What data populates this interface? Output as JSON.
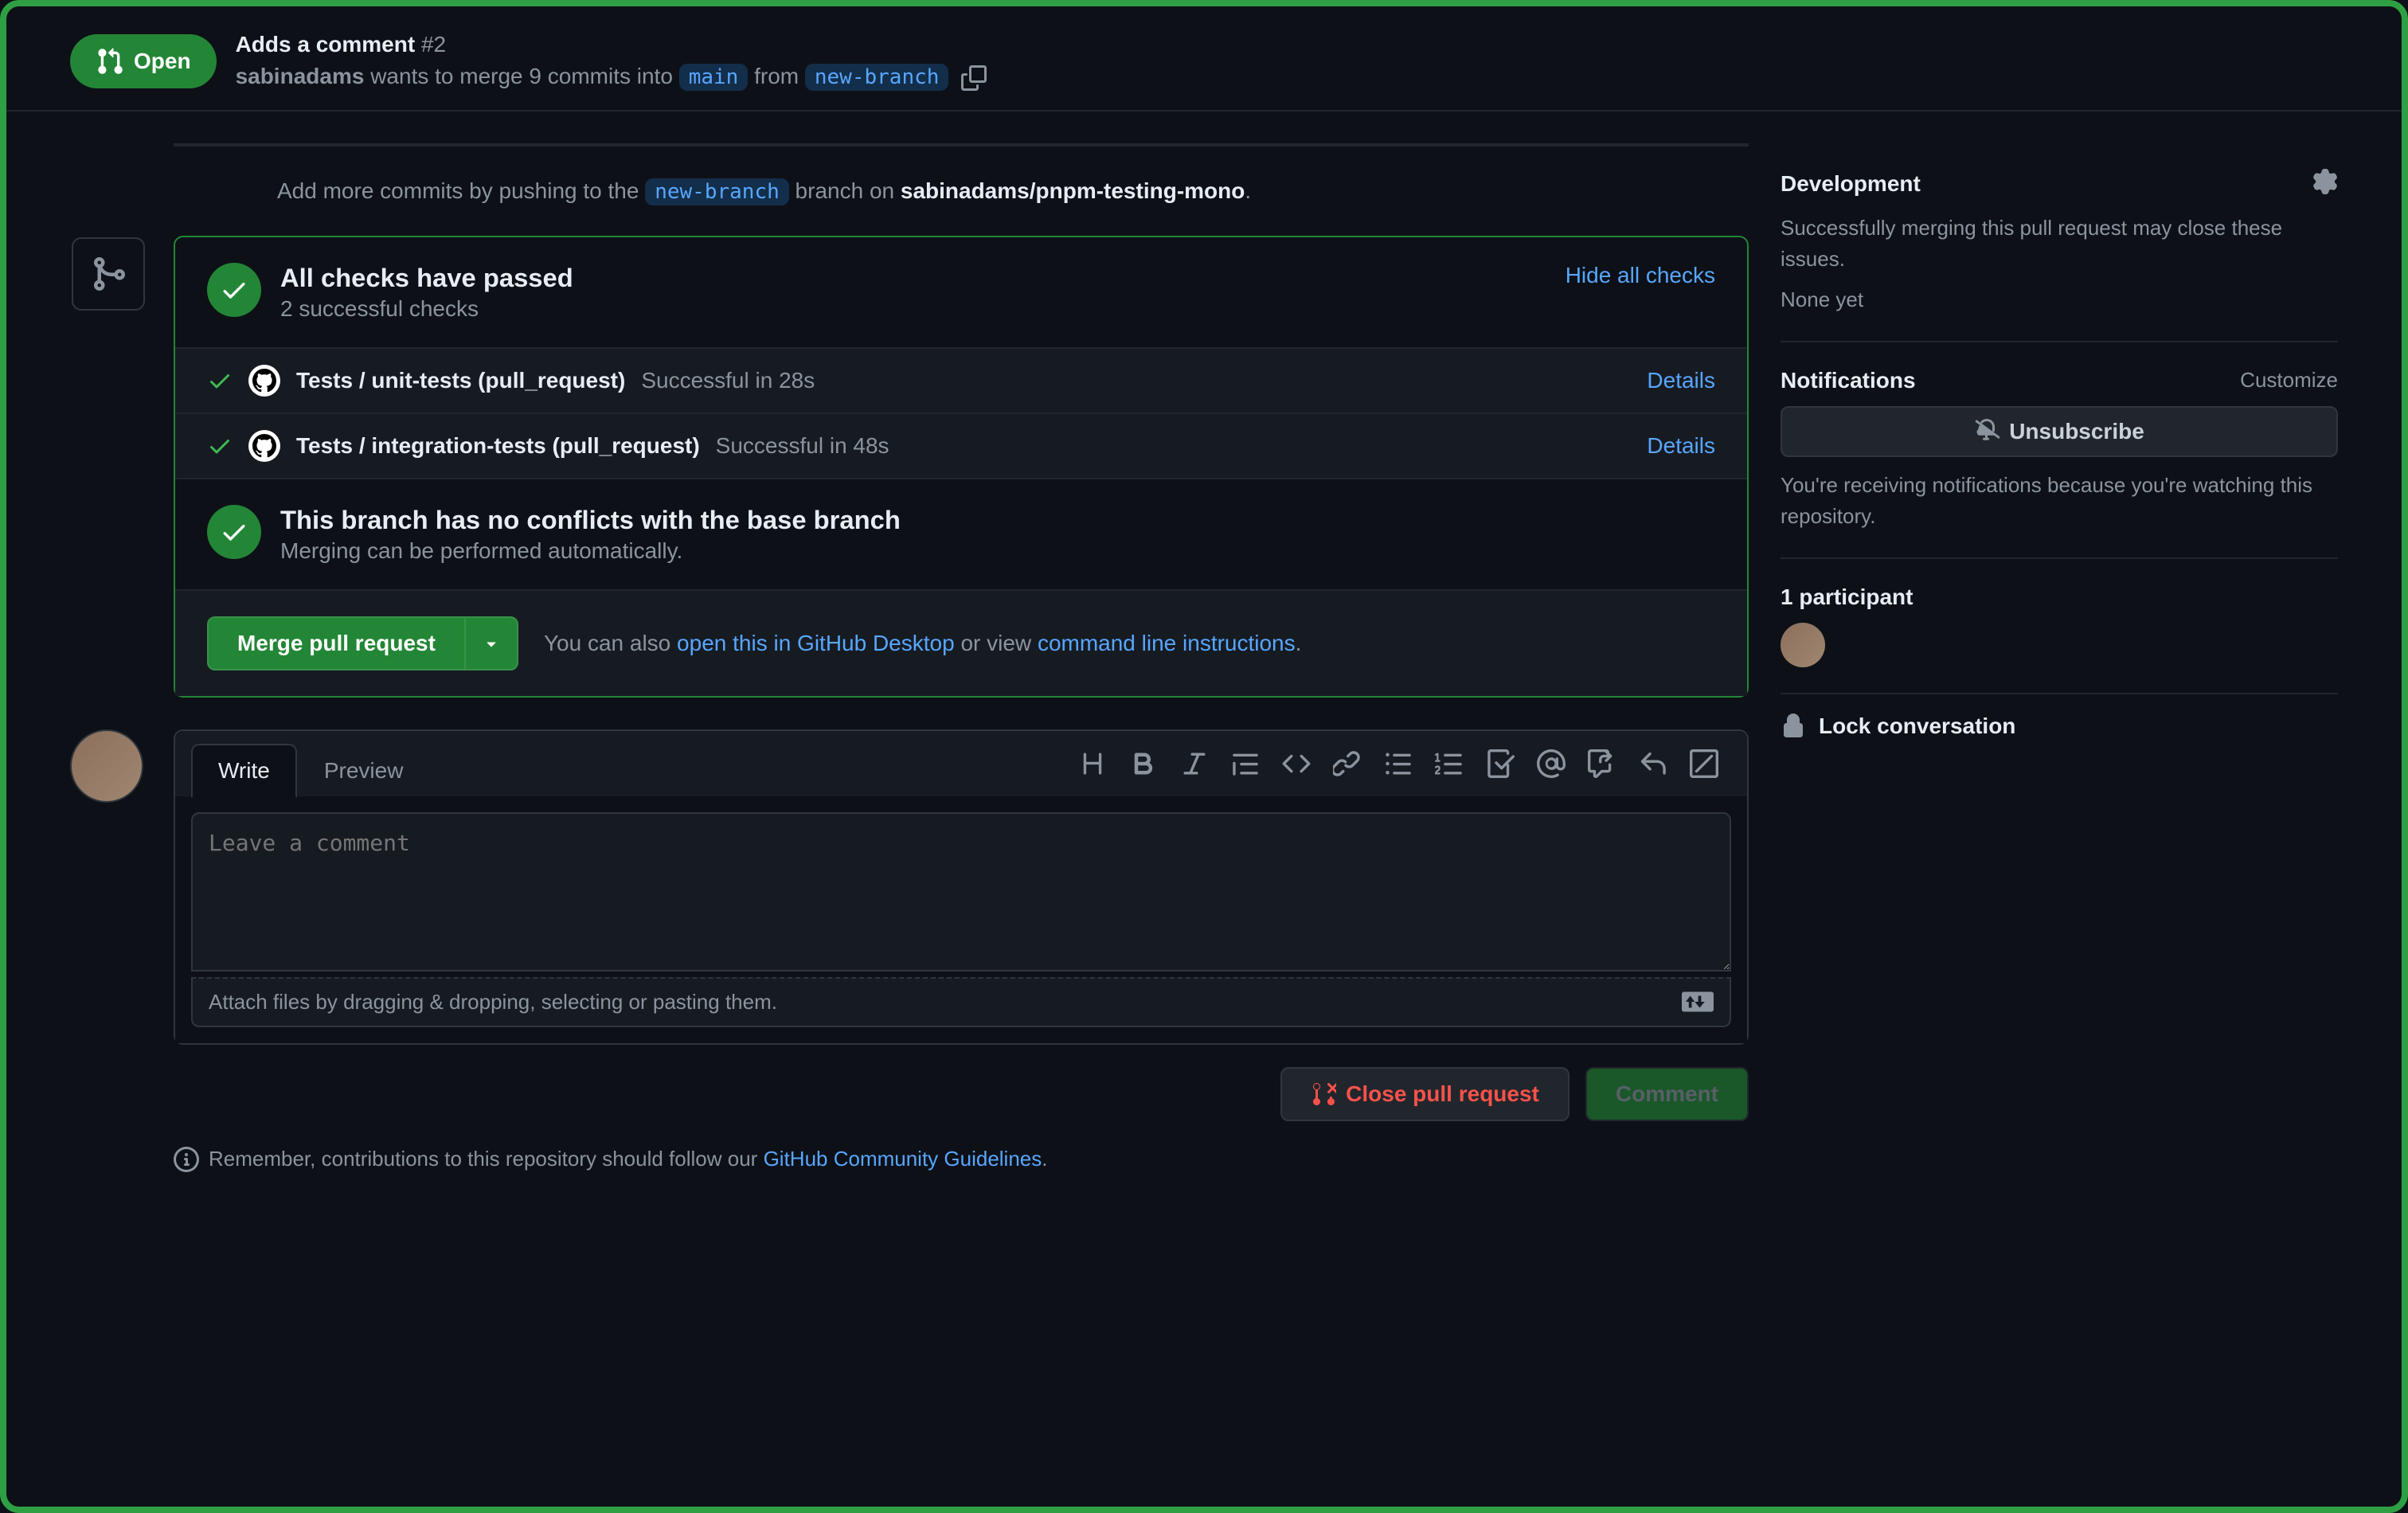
{
  "header": {
    "state": "Open",
    "title": "Adds a comment",
    "number": "#2",
    "author": "sabinadams",
    "wants_to_merge": " wants to merge 9 commits into ",
    "into_branch": "main",
    "from_word": " from ",
    "from_branch": "new-branch"
  },
  "commit_hint": {
    "prefix": "Add more commits by pushing to the ",
    "branch": "new-branch",
    "middle": " branch on ",
    "repo": "sabinadams/pnpm-testing-mono",
    "suffix": "."
  },
  "checks": {
    "title": "All checks have passed",
    "subtitle": "2 successful checks",
    "hide": "Hide all checks",
    "rows": [
      {
        "name": "Tests / unit-tests (pull_request)",
        "status": "Successful in 28s",
        "details": "Details"
      },
      {
        "name": "Tests / integration-tests (pull_request)",
        "status": "Successful in 48s",
        "details": "Details"
      }
    ]
  },
  "conflicts": {
    "title": "This branch has no conflicts with the base branch",
    "subtitle": "Merging can be performed automatically."
  },
  "merge_action": {
    "button": "Merge pull request",
    "prefix": "You can also ",
    "link1": "open this in GitHub Desktop",
    "middle": " or view ",
    "link2": "command line instructions",
    "suffix": "."
  },
  "editor": {
    "tabs": {
      "write": "Write",
      "preview": "Preview"
    },
    "placeholder": "Leave a comment",
    "attach": "Attach files by dragging & dropping, selecting or pasting them."
  },
  "actions": {
    "close": "Close pull request",
    "comment": "Comment"
  },
  "footer": {
    "prefix": "Remember, contributions to this repository should follow our ",
    "link": "GitHub Community Guidelines",
    "suffix": "."
  },
  "sidebar": {
    "development": {
      "title": "Development",
      "text": "Successfully merging this pull request may close these issues.",
      "none": "None yet"
    },
    "notifications": {
      "title": "Notifications",
      "customize": "Customize",
      "unsubscribe": "Unsubscribe",
      "reason": "You're receiving notifications because you're watching this repository."
    },
    "participants": {
      "title": "1 participant"
    },
    "lock": "Lock conversation"
  }
}
